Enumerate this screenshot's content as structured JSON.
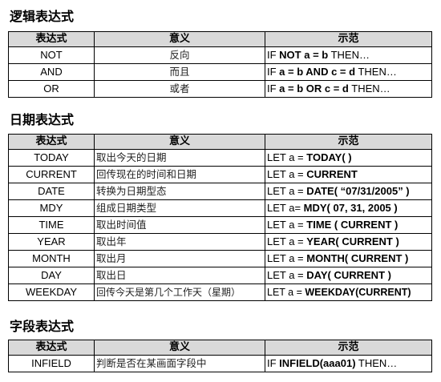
{
  "sections": [
    {
      "title": "逻辑表达式",
      "headers": [
        "表达式",
        "意义",
        "示范"
      ],
      "rows": [
        {
          "expr": "NOT",
          "meaning": "反向",
          "ex_pre": "IF ",
          "ex_bold": "NOT a = b",
          "ex_post": " THEN…"
        },
        {
          "expr": "AND",
          "meaning": "而且",
          "ex_pre": "IF ",
          "ex_bold": "a = b AND c = d",
          "ex_post": " THEN…"
        },
        {
          "expr": "OR",
          "meaning": "或者",
          "ex_pre": "IF ",
          "ex_bold": "a = b OR c = d",
          "ex_post": " THEN…"
        }
      ]
    },
    {
      "title": "日期表达式",
      "headers": [
        "表达式",
        "意义",
        "示范"
      ],
      "rows": [
        {
          "expr": "TODAY",
          "meaning": "取出今天的日期",
          "ex_pre": "LET a = ",
          "ex_bold": "TODAY( )",
          "ex_post": ""
        },
        {
          "expr": "CURRENT",
          "meaning": "回传现在的时间和日期",
          "ex_pre": "LET a = ",
          "ex_bold": "CURRENT",
          "ex_post": ""
        },
        {
          "expr": "DATE",
          "meaning": "转换为日期型态",
          "ex_pre": "LET a = ",
          "ex_bold": "DATE( “07/31/2005” )",
          "ex_post": ""
        },
        {
          "expr": "MDY",
          "meaning": "组成日期类型",
          "ex_pre": "LET a= ",
          "ex_bold": "MDY( 07, 31, 2005 )",
          "ex_post": ""
        },
        {
          "expr": "TIME",
          "meaning": "取出时间值",
          "ex_pre": "LET a = ",
          "ex_bold": "TIME ( CURRENT )",
          "ex_post": ""
        },
        {
          "expr": "YEAR",
          "meaning": "取出年",
          "ex_pre": "LET a = ",
          "ex_bold": "YEAR( CURRENT )",
          "ex_post": ""
        },
        {
          "expr": "MONTH",
          "meaning": "取出月",
          "ex_pre": "LET a = ",
          "ex_bold": "MONTH( CURRENT )",
          "ex_post": ""
        },
        {
          "expr": "DAY",
          "meaning": "取出日",
          "ex_pre": "LET a = ",
          "ex_bold": "DAY( CURRENT )",
          "ex_post": ""
        },
        {
          "expr": "WEEKDAY",
          "meaning": "回传今天是第几个工作天（星期）",
          "ex_pre": "LET a = ",
          "ex_bold": "WEEKDAY(CURRENT)",
          "ex_post": ""
        }
      ]
    },
    {
      "title": "字段表达式",
      "headers": [
        "表达式",
        "意义",
        "示范"
      ],
      "rows": [
        {
          "expr": "INFIELD",
          "meaning": "判断是否在某画面字段中",
          "ex_pre": "IF ",
          "ex_bold": "INFIELD(aaa01)",
          "ex_post": " THEN…"
        }
      ]
    }
  ]
}
